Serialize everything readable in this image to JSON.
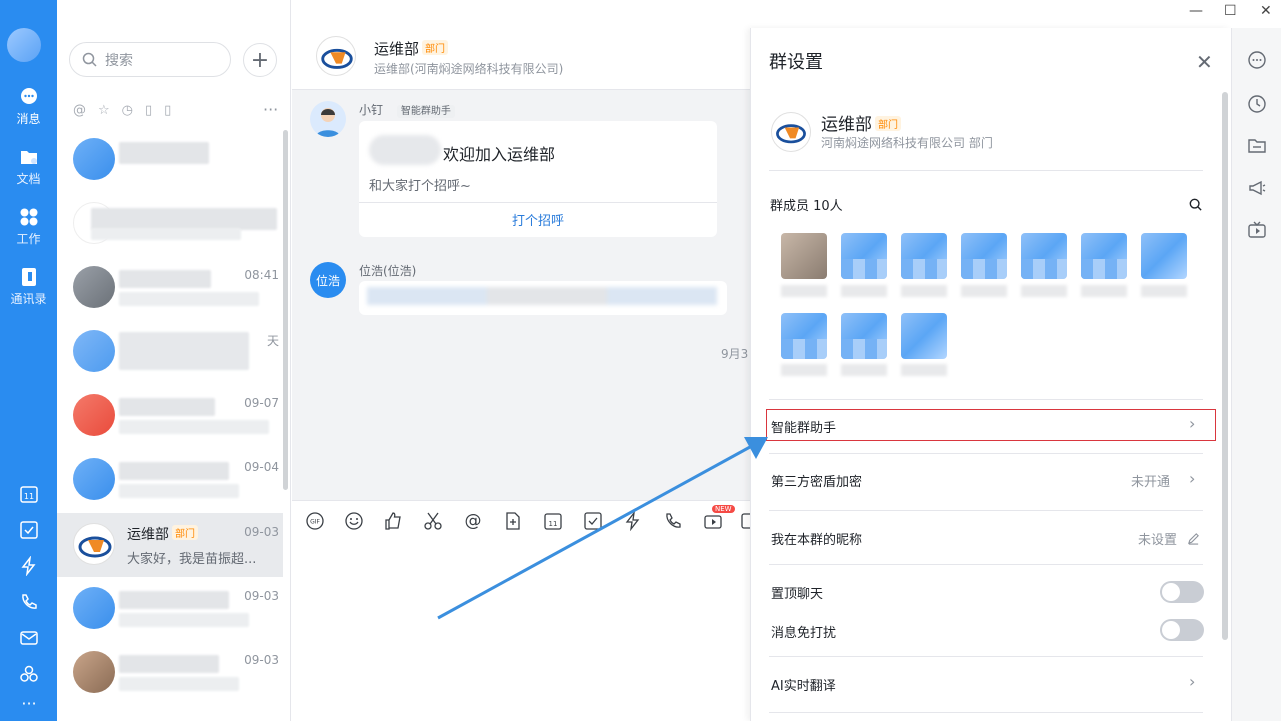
{
  "nav": {
    "items": [
      {
        "name": "messages",
        "label": "消息",
        "icon": "chat-bubble-icon"
      },
      {
        "name": "docs",
        "label": "文档",
        "icon": "folder-icon"
      },
      {
        "name": "work",
        "label": "工作",
        "icon": "grid-icon"
      },
      {
        "name": "contacts",
        "label": "通讯录",
        "icon": "address-book-icon"
      }
    ],
    "bottom_icons": [
      "calendar-icon",
      "todo-check-icon",
      "ding-lightning-icon",
      "phone-icon",
      "mail-icon",
      "apps-icon",
      "more-icon"
    ],
    "calendar_day": "11",
    "more": "···"
  },
  "chatlist": {
    "search_placeholder": "搜索",
    "plus": "+",
    "filter_icons": [
      "at-icon",
      "star-icon",
      "clock-icon",
      "doc-icon",
      "file-icon"
    ],
    "filter_more": "···",
    "chats": [
      {
        "name": "",
        "msg": "",
        "time": ""
      },
      {
        "name": "",
        "msg": "",
        "time": ""
      },
      {
        "name": "",
        "msg": "",
        "time": "08:41"
      },
      {
        "name": "",
        "msg": "",
        "time": "天"
      },
      {
        "name": "",
        "msg": "",
        "time": "09-07"
      },
      {
        "name": "",
        "msg": "",
        "time": "09-04"
      },
      {
        "name": "运维部",
        "tag": "部门",
        "msg": "大家好，我是苗振超...",
        "time": "09-03"
      },
      {
        "name": "",
        "msg": "",
        "time": "09-03"
      },
      {
        "name": "",
        "msg": "",
        "time": "09-03"
      }
    ]
  },
  "conversation": {
    "title": "运维部",
    "title_tag": "部门",
    "subtitle": "运维部(河南焖途网络科技有限公司)",
    "bot_name": "小钉",
    "bot_tag": "智能群助手",
    "welcome_title": "欢迎加入运维部",
    "welcome_sub": "和大家打个招呼~",
    "welcome_button": "打个招呼",
    "sender_name": "位浩(位浩)",
    "sender_avatar_text": "位浩",
    "date_divider": "9月3",
    "toolbar_icons": [
      "gif-icon",
      "emoji-icon",
      "thumbs-up-icon",
      "scissors-icon",
      "at-icon",
      "add-doc-icon",
      "calendar-icon",
      "todo-icon",
      "ding-icon",
      "phone-icon",
      "live-icon",
      "more-icon"
    ],
    "toolbar_gif": "GIF",
    "toolbar_new": "NEW"
  },
  "window": {
    "controls": [
      "minimize-icon",
      "maximize-icon",
      "close-icon"
    ],
    "min": "—",
    "max": "☐",
    "close": "✕"
  },
  "settings": {
    "title": "群设置",
    "close": "✕",
    "group_name": "运维部",
    "group_tag": "部门",
    "group_sub": "河南焖途网络科技有限公司 部门",
    "members_label": "群成员 10人",
    "rows": [
      {
        "label": "智能群助手",
        "value": ""
      },
      {
        "label": "第三方密盾加密",
        "value": "未开通"
      },
      {
        "label": "我在本群的昵称",
        "value": "未设置"
      }
    ],
    "toggles": [
      {
        "label": "置顶聊天",
        "on": false
      },
      {
        "label": "消息免打扰",
        "on": false
      }
    ],
    "ai_translate": "AI实时翻译"
  },
  "rightbar": {
    "icons": [
      "more-circle-icon",
      "history-clock-icon",
      "files-folder-icon",
      "announcement-icon",
      "live-tv-icon"
    ]
  },
  "colors": {
    "nav_blue": "#2a8cf0",
    "accent": "#2a7cdb",
    "tag_orange": "#ff8800",
    "highlight_red": "#d9363e",
    "arrow_blue": "#3b8fde"
  }
}
